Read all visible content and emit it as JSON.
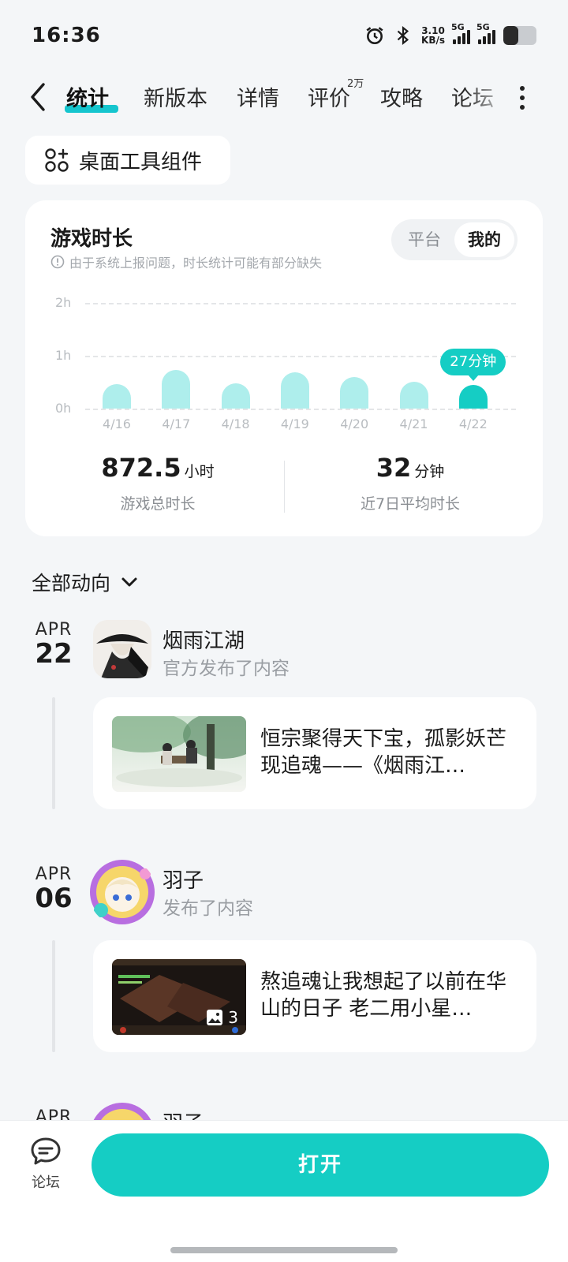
{
  "status": {
    "time": "16:36",
    "net_speed_value": "3.10",
    "net_speed_unit": "KB/s",
    "signal1_label": "5G",
    "signal2_label": "5G",
    "battery_level": 0.45,
    "icons": [
      "alarm-icon",
      "bluetooth-icon",
      "signal-icon",
      "battery-icon"
    ]
  },
  "tabs": {
    "items": [
      {
        "label": "统计",
        "active": true
      },
      {
        "label": "新版本"
      },
      {
        "label": "详情"
      },
      {
        "label": "评价",
        "badge": "2万"
      },
      {
        "label": "攻略"
      },
      {
        "label": "论坛"
      }
    ]
  },
  "widget_button": {
    "label": "桌面工具组件",
    "icon": "widget-icon"
  },
  "stats": {
    "title": "游戏时长",
    "note": "由于系统上报问题，时长统计可能有部分缺失",
    "toggle": [
      "平台",
      "我的"
    ],
    "toggle_selected": "我的",
    "bubble": "27分钟",
    "total_value": "872.5",
    "total_unit": "小时",
    "total_label": "游戏总时长",
    "avg_value": "32",
    "avg_unit": "分钟",
    "avg_label": "近7日平均时长"
  },
  "chart_data": {
    "type": "bar",
    "categories": [
      "4/16",
      "4/17",
      "4/18",
      "4/19",
      "4/20",
      "4/21",
      "4/22"
    ],
    "values": [
      0.47,
      0.73,
      0.48,
      0.69,
      0.59,
      0.51,
      0.45
    ],
    "y_ticks": [
      "2h",
      "1h",
      "0h"
    ],
    "ylim": [
      0,
      2
    ],
    "grid": true,
    "highlight_index": 6,
    "colors": {
      "bar": "#aeeeec",
      "highlight": "#15cdc4"
    }
  },
  "feed": {
    "header": "全部动向",
    "entries": [
      {
        "month": "APR",
        "day": "22",
        "name": "烟雨江湖",
        "sub": "官方发布了内容",
        "text": "恒宗聚得天下宝，孤影妖芒现追魂——《烟雨江…"
      },
      {
        "month": "APR",
        "day": "06",
        "name": "羽子",
        "sub": "发布了内容",
        "text": "熬追魂让我想起了以前在华山的日子 老二用小星…",
        "image_count": "3"
      },
      {
        "month": "APR",
        "name": "羽子"
      }
    ]
  },
  "bottom": {
    "forum_label": "论坛",
    "open_label": "打开"
  },
  "colors": {
    "accent": "#15cdc4",
    "background": "#f4f6f8"
  }
}
